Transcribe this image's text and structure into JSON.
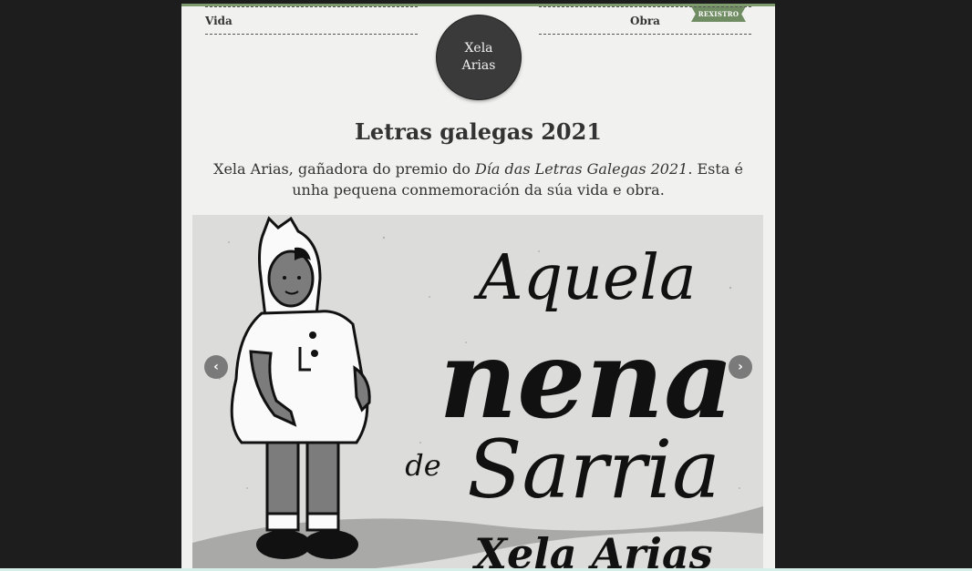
{
  "header": {
    "ribbon_label": "REXISTRO",
    "nav_left": "Vida",
    "nav_right": "Obra",
    "logo_line1": "Xela",
    "logo_line2": "Arias"
  },
  "main": {
    "title": "Letras galegas 2021",
    "intro_prefix": "Xela Arias, gañadora do premio do ",
    "intro_emph": "Día das Letras Galegas 2021",
    "intro_suffix": ". Esta é unha pequena conmemoración da súa vida e obra."
  },
  "carousel": {
    "slide_word1": "Aquela",
    "slide_word2": "nena",
    "slide_word3": "de",
    "slide_word4": "Sarria",
    "slide_word5": "Xela Arias",
    "prev_icon": "chevron-left-icon",
    "next_icon": "chevron-right-icon"
  }
}
